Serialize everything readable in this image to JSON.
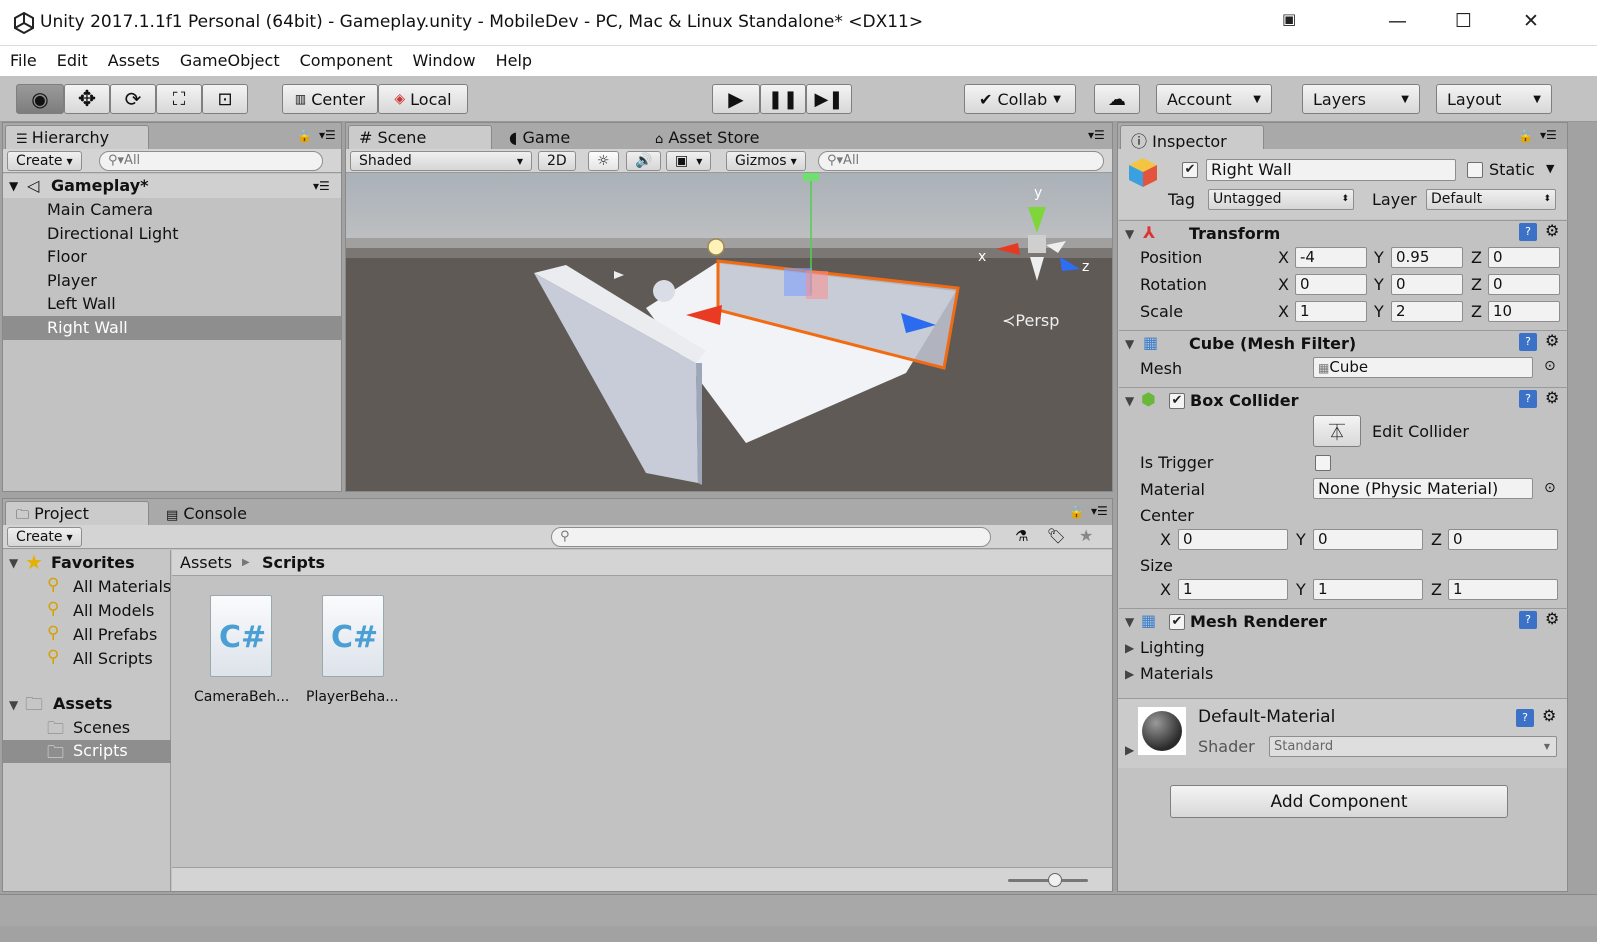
{
  "window": {
    "title": "Unity 2017.1.1f1 Personal (64bit) - Gameplay.unity - MobileDev - PC, Mac & Linux Standalone* <DX11>"
  },
  "menu": [
    "File",
    "Edit",
    "Assets",
    "GameObject",
    "Component",
    "Window",
    "Help"
  ],
  "toolbar": {
    "center": "Center",
    "local": "Local",
    "collab": "Collab",
    "account": "Account",
    "layers": "Layers",
    "layout": "Layout"
  },
  "hierarchy": {
    "tab": "Hierarchy",
    "create": "Create",
    "search_placeholder": "All",
    "scene": "Gameplay*",
    "items": [
      "Main Camera",
      "Directional Light",
      "Floor",
      "Player",
      "Left Wall",
      "Right Wall"
    ],
    "selected_index": 5
  },
  "scene_tabs": [
    "Scene",
    "Game",
    "Asset Store"
  ],
  "scene": {
    "shading": "Shaded",
    "mode_2d": "2D",
    "gizmos": "Gizmos",
    "search_placeholder": "All",
    "persp": "Persp",
    "axis_x": "x",
    "axis_y": "y",
    "axis_z": "z"
  },
  "project": {
    "tab_project": "Project",
    "tab_console": "Console",
    "create": "Create",
    "favorites": "Favorites",
    "favorite_items": [
      "All Materials",
      "All Models",
      "All Prefabs",
      "All Scripts"
    ],
    "assets": "Assets",
    "asset_folders": [
      "Scenes",
      "Scripts"
    ],
    "breadcrumb": [
      "Assets",
      "Scripts"
    ],
    "files": [
      {
        "name": "CameraBeh...",
        "glyph": "C#"
      },
      {
        "name": "PlayerBeha...",
        "glyph": "C#"
      }
    ]
  },
  "inspector": {
    "tab": "Inspector",
    "object_name": "Right Wall",
    "static_label": "Static",
    "tag_label": "Tag",
    "tag_value": "Untagged",
    "layer_label": "Layer",
    "layer_value": "Default",
    "transform": {
      "title": "Transform",
      "position_label": "Position",
      "rotation_label": "Rotation",
      "scale_label": "Scale",
      "position": {
        "x": "-4",
        "y": "0.95",
        "z": "0"
      },
      "rotation": {
        "x": "0",
        "y": "0",
        "z": "0"
      },
      "scale": {
        "x": "1",
        "y": "2",
        "z": "10"
      }
    },
    "mesh_filter": {
      "title": "Cube (Mesh Filter)",
      "mesh_label": "Mesh",
      "mesh_value": "Cube"
    },
    "box_collider": {
      "title": "Box Collider",
      "edit_collider": "Edit Collider",
      "is_trigger": "Is Trigger",
      "material_label": "Material",
      "material_value": "None (Physic Material)",
      "center_label": "Center",
      "center": {
        "x": "0",
        "y": "0",
        "z": "0"
      },
      "size_label": "Size",
      "size": {
        "x": "1",
        "y": "1",
        "z": "1"
      }
    },
    "mesh_renderer": {
      "title": "Mesh Renderer",
      "lighting": "Lighting",
      "materials": "Materials"
    },
    "material": {
      "name": "Default-Material",
      "shader_label": "Shader",
      "shader_value": "Standard"
    },
    "add_component": "Add Component",
    "x": "X",
    "y": "Y",
    "z": "Z"
  }
}
